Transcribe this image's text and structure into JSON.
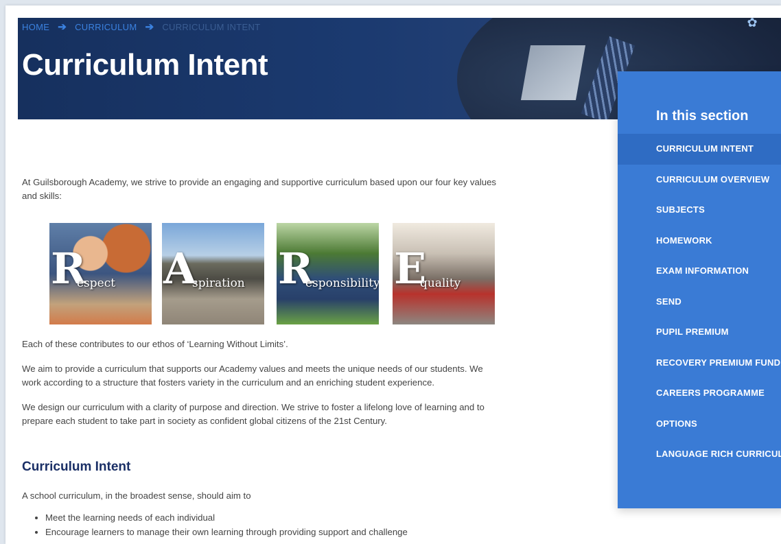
{
  "breadcrumb": {
    "home": "HOME",
    "curriculum": "CURRICULUM",
    "current": "CURRICULUM INTENT"
  },
  "page_title": "Curriculum Intent",
  "sidebar": {
    "heading": "In this section",
    "items": [
      {
        "label": "CURRICULUM INTENT",
        "active": true
      },
      {
        "label": "CURRICULUM OVERVIEW"
      },
      {
        "label": "SUBJECTS"
      },
      {
        "label": "HOMEWORK"
      },
      {
        "label": "EXAM INFORMATION"
      },
      {
        "label": "SEND"
      },
      {
        "label": "PUPIL PREMIUM"
      },
      {
        "label": "RECOVERY PREMIUM FUNDING"
      },
      {
        "label": "CAREERS PROGRAMME"
      },
      {
        "label": "OPTIONS"
      },
      {
        "label": "LANGUAGE RICH CURRICULUM"
      }
    ]
  },
  "content": {
    "intro": "At Guilsborough Academy, we strive to provide an engaging and supportive curriculum based upon our four key values and skills:",
    "values": [
      {
        "initial": "R",
        "rest": "espect"
      },
      {
        "initial": "A",
        "rest": "spiration"
      },
      {
        "initial": "R",
        "rest": "esponsibility"
      },
      {
        "initial": "E",
        "rest": "quality"
      }
    ],
    "p1": "Each of these contributes to our ethos of ‘Learning Without Limits’.",
    "p2": "We aim to provide a curriculum that supports our Academy values and meets the unique needs of our students. We work according to a structure that fosters variety in the curriculum and an enriching student experience.",
    "p3": "We design our curriculum with a clarity of purpose and direction. We strive to foster a lifelong love of learning and to prepare each student to take part in society as confident global citizens of the 21st Century.",
    "section_heading": "Curriculum Intent",
    "section_intro": "A school curriculum, in the broadest sense, should aim to",
    "bullets": [
      "Meet the learning needs of each individual",
      "Encourage learners to manage their own learning through providing support and challenge"
    ]
  },
  "colors": {
    "hero_bg": "#16305e",
    "sidebar_bg": "#3a7bd5",
    "sidebar_active": "#2f6cc3",
    "heading": "#1a2f66",
    "link": "#3b82e0"
  }
}
